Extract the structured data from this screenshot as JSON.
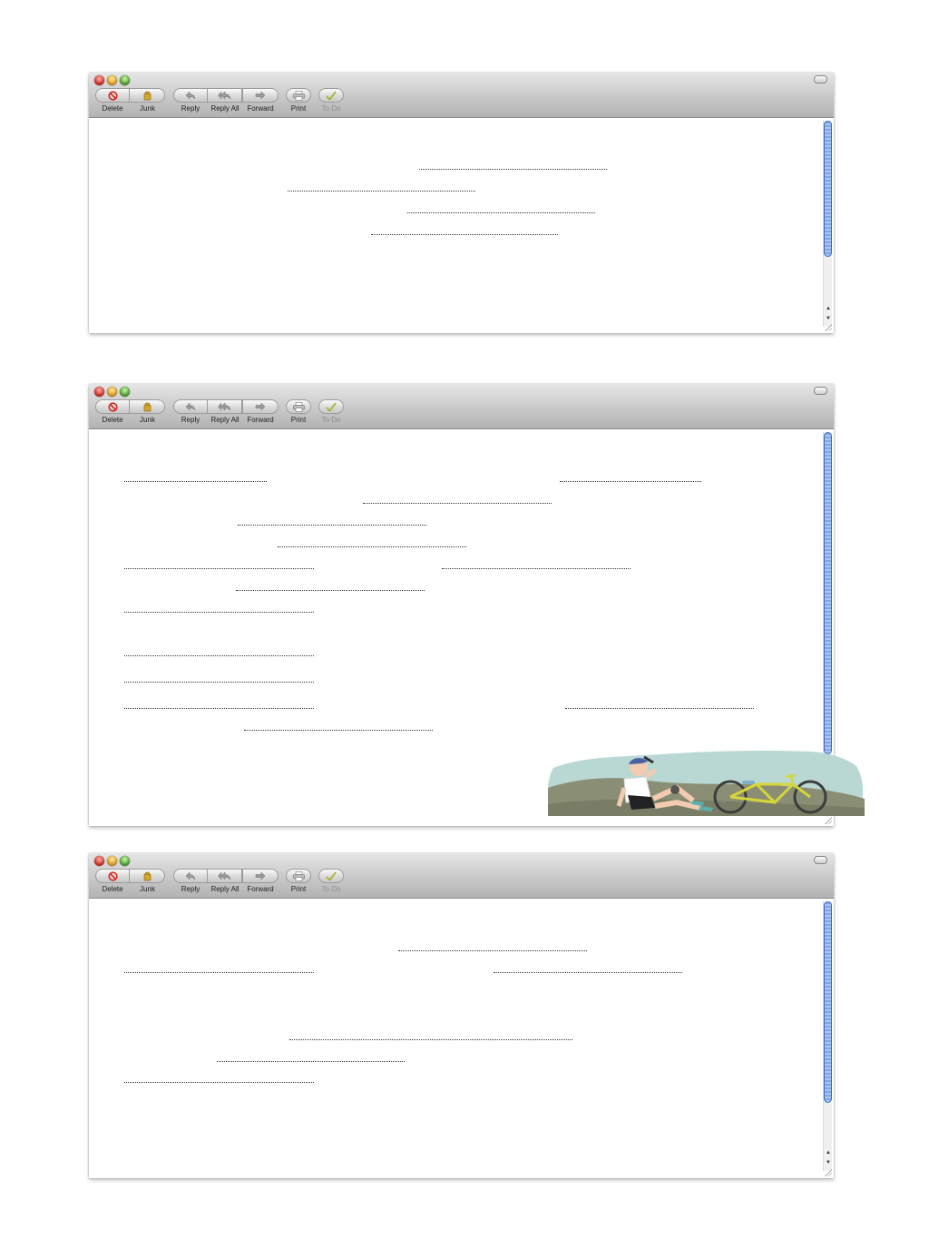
{
  "toolbar": {
    "delete_label": "Delete",
    "junk_label": "Junk",
    "reply_label": "Reply",
    "reply_all_label": "Reply All",
    "forward_label": "Forward",
    "print_label": "Print",
    "todo_label": "To Do"
  },
  "icons": {
    "delete": "no-entry-icon",
    "junk": "junk-bag-icon",
    "reply": "reply-arrow-icon",
    "reply_all": "reply-all-arrow-icon",
    "forward": "forward-arrow-icon",
    "print": "printer-icon",
    "todo": "checkmark-icon"
  },
  "colors": {
    "close": "#d9291e",
    "minimize": "#e6a11a",
    "zoom": "#4ea52c",
    "delete_icon": "#d32a1e",
    "junk_icon": "#c79a24",
    "todo_icon": "#a5b12d",
    "scroll_thumb": "#7ea6e6"
  },
  "windows": [
    {
      "id": "window-1",
      "fill_in_blanks": 4
    },
    {
      "id": "window-2",
      "fill_in_blanks": 14,
      "illustration": "cyclist-resting-beside-bicycle"
    },
    {
      "id": "window-3",
      "fill_in_blanks": 6
    }
  ]
}
